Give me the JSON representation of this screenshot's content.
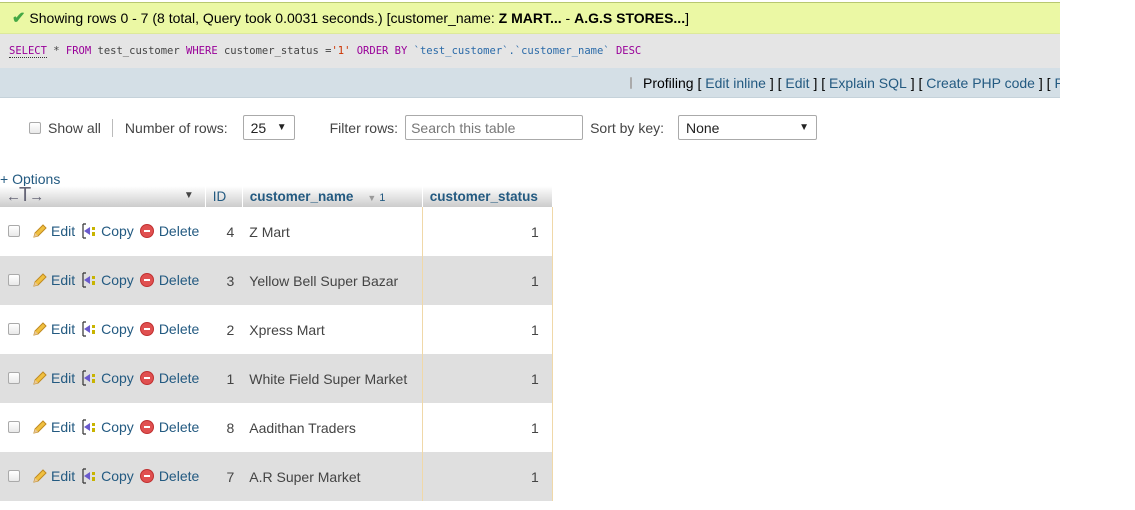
{
  "success": {
    "icon": "check-icon",
    "prefix": "Showing rows 0 - 7 (8 total, Query took 0.0031 seconds.) [customer_name: ",
    "from_value": "Z MART...",
    "dash": " - ",
    "to_value": "A.G.S STORES...",
    "suffix": "]"
  },
  "sql": {
    "select": "SELECT",
    "star": " * ",
    "from": "FROM",
    "table": " test_customer ",
    "where": "WHERE",
    "column": " customer_status =",
    "value": "'1'",
    "space": " ",
    "order_by": "ORDER BY",
    "sort_col": " `test_customer`.`customer_name` ",
    "desc": "DESC"
  },
  "tools": {
    "profiling_label": "Profiling",
    "links": [
      "Edit inline",
      "Edit",
      "Explain SQL",
      "Create PHP code",
      "Refresh"
    ]
  },
  "nav": {
    "show_all_label": "Show all",
    "rows_label": "Number of rows:",
    "rows_value": "25",
    "filter_label": "Filter rows:",
    "filter_placeholder": "Search this table",
    "sort_label": "Sort by key:",
    "sort_value": "None"
  },
  "options_link": "+ Options",
  "table": {
    "columns": {
      "id": "ID",
      "name": "customer_name",
      "name_sort_order": "1",
      "status": "customer_status"
    },
    "actions": {
      "edit": "Edit",
      "copy": "Copy",
      "delete": "Delete"
    },
    "rows": [
      {
        "id": "4",
        "customer_name": "Z Mart",
        "customer_status": "1"
      },
      {
        "id": "3",
        "customer_name": "Yellow Bell Super Bazar",
        "customer_status": "1"
      },
      {
        "id": "2",
        "customer_name": "Xpress Mart",
        "customer_status": "1"
      },
      {
        "id": "1",
        "customer_name": "White Field Super Market",
        "customer_status": "1"
      },
      {
        "id": "8",
        "customer_name": "Aadithan Traders",
        "customer_status": "1"
      },
      {
        "id": "7",
        "customer_name": "A.R Super Market",
        "customer_status": "1"
      }
    ]
  },
  "colors": {
    "success_bg": "#ebf8a4",
    "link": "#235a81",
    "row_alt": "#dfdfdf"
  }
}
